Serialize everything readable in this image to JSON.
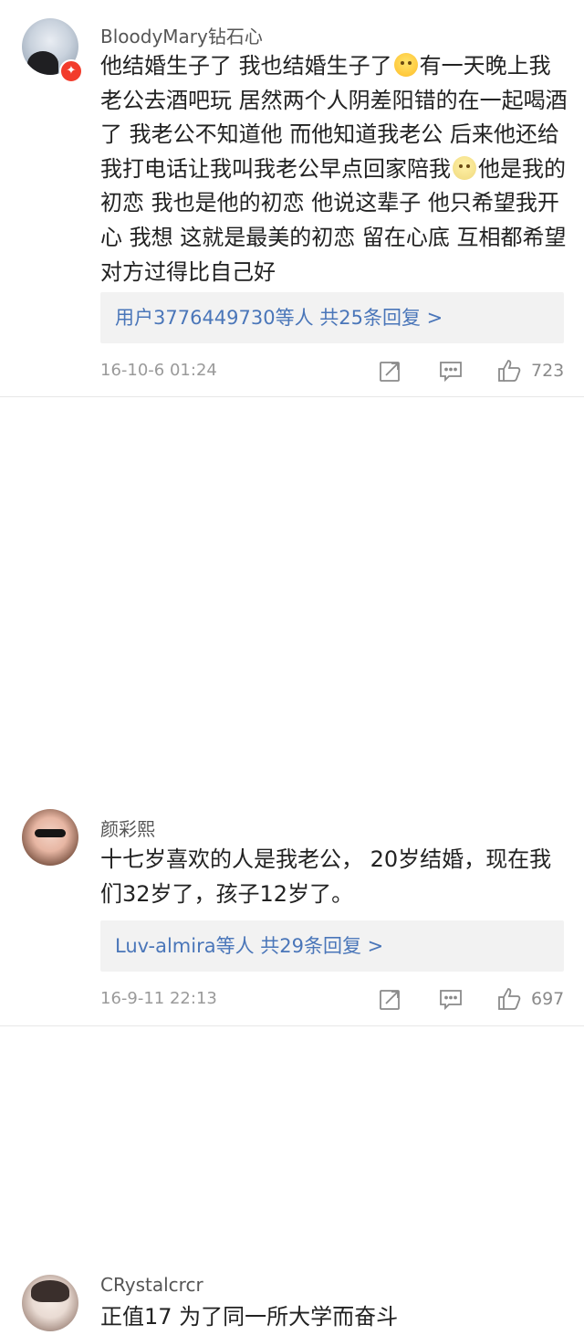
{
  "colors": {
    "link_blue": "#4a76b9",
    "meta_gray": "#9a9a9a",
    "badge_red": "#f23c2c",
    "reply_box_bg": "#f2f2f2"
  },
  "icons": {
    "repost": "repost-icon",
    "reply": "comment-icon",
    "like": "thumbs-up-icon"
  },
  "comments": [
    {
      "username": "BloodyMary钻石心",
      "badge": "✦",
      "text_part1": "他结婚生子了 我也结婚生子了",
      "emoji1": "smile-emoji",
      "text_part2": "有一天晚上我老公去酒吧玩 居然两个人阴差阳错的在一起喝酒了 我老公不知道他 而他知道我老公 后来他还给我打电话让我叫我老公早点回家陪我",
      "emoji2": "sad-emoji",
      "text_part3": "他是我的初恋 我也是他的初恋 他说这辈子 他只希望我开心 我想 这就是最美的初恋 留在心底 互相都希望对方过得比自己好",
      "replies": "用户3776449730等人 共25条回复 >",
      "timestamp": "16-10-6 01:24",
      "likes": "723"
    },
    {
      "username": "颜彩熙",
      "text": "十七岁喜欢的人是我老公， 20岁结婚，现在我们32岁了，孩子12岁了。",
      "replies": "Luv-almira等人 共29条回复 >",
      "timestamp": "16-9-11 22:13",
      "likes": "697"
    },
    {
      "username": "CRystalcrcr",
      "text": "正值17 为了同一所大学而奋斗"
    }
  ]
}
